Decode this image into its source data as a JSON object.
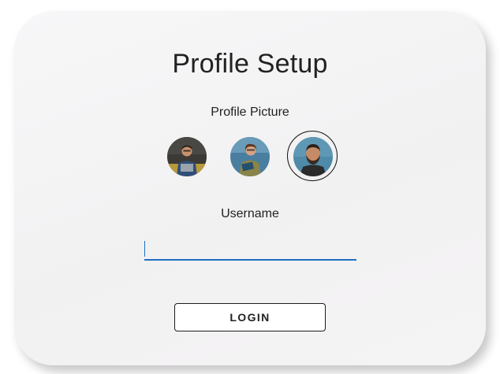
{
  "title": "Profile Setup",
  "profile_picture": {
    "label": "Profile Picture",
    "options": [
      {
        "icon": "avatar-man-laptop",
        "selected": false
      },
      {
        "icon": "avatar-woman-notebook",
        "selected": false
      },
      {
        "icon": "avatar-man-bearded",
        "selected": true
      }
    ]
  },
  "username": {
    "label": "Username",
    "value": "",
    "placeholder": ""
  },
  "login_button": {
    "label": "LOGIN"
  },
  "colors": {
    "accent": "#1f6fc1",
    "text": "#222222",
    "card_background": "#f4f3f4"
  }
}
